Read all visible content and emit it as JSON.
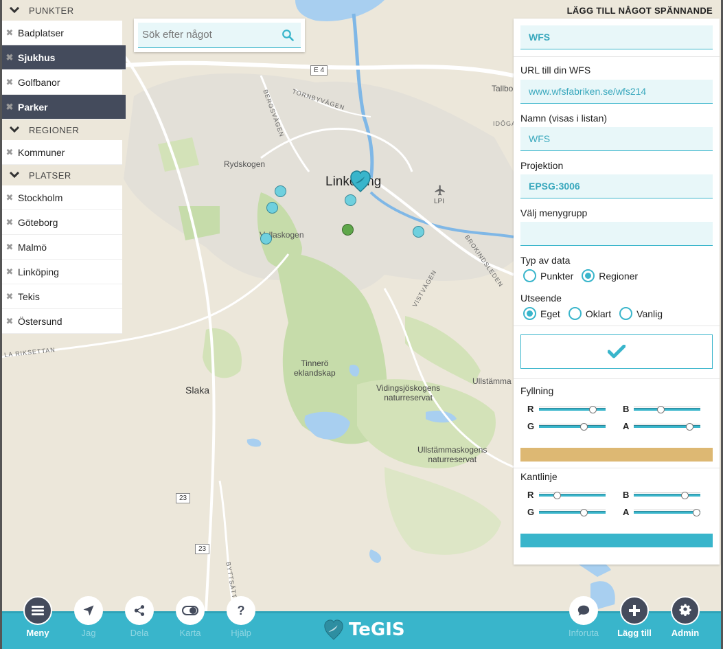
{
  "map": {
    "labels": {
      "city": "Linköping",
      "slaka": "Slaka",
      "rydskogen": "Rydskogen",
      "vallaskogen": "Vallaskogen",
      "lpi": "LPI",
      "tinnero": "Tinnerö\neklandskap",
      "vidingsjo": "Vidingsjöskogens\nnaturreservat",
      "ullstamma_nr": "Ullstämmaskogens\nnaturreservat",
      "ullstamma": "Ullstämma",
      "tallboda": "Tallbo",
      "tornbyvagen": "TORNBYVÄGEN",
      "bergsvagen": "BERGSVÄGEN",
      "idogatan": "IDÖGA",
      "brokindsleden": "BROKINDSLEDEN",
      "vistvagen": "VISTVÄGEN",
      "riksettan": "LA RIKSETTAN",
      "byttsatt": "BYTTSÄTT",
      "e4": "E 4",
      "r23a": "23",
      "r23b": "23"
    }
  },
  "leftmenu": {
    "sections": [
      {
        "title": "PUNKTER",
        "items": [
          "Badplatser",
          "Sjukhus",
          "Golfbanor",
          "Parker"
        ]
      },
      {
        "title": "REGIONER",
        "items": [
          "Kommuner"
        ]
      },
      {
        "title": "PLATSER",
        "items": [
          "Stockholm",
          "Göteborg",
          "Malmö",
          "Linköping",
          "Tekis",
          "Östersund"
        ]
      }
    ]
  },
  "search": {
    "placeholder": "Sök efter något"
  },
  "panel": {
    "title": "LÄGG TILL NÅGOT SPÄNNANDE",
    "type_field": "WFS",
    "url_label": "URL till din WFS",
    "url_value": "www.wfsfabriken.se/wfs214",
    "name_label": "Namn (visas i listan)",
    "name_value": "WFS",
    "projection_label": "Projektion",
    "projection_value": "EPSG:3006",
    "menugroup_label": "Välj menygrupp",
    "menugroup_value": "",
    "datatype_label": "Typ av data",
    "datatype_options": [
      "Punkter",
      "Regioner"
    ],
    "datatype_selected": "Regioner",
    "appearance_label": "Utseende",
    "appearance_options": [
      "Eget",
      "Oklart",
      "Vanlig"
    ],
    "appearance_selected": "Eget",
    "fill_label": "Fyllning",
    "stroke_label": "Kantlinje",
    "channel_labels": {
      "r": "R",
      "g": "G",
      "b": "B",
      "a": "A"
    },
    "fill_values": {
      "r": 0.8,
      "g": 0.67,
      "b": 0.4,
      "a": 0.84
    },
    "stroke_values": {
      "r": 0.27,
      "g": 0.67,
      "b": 0.76,
      "a": 0.94
    },
    "fill_color": "#ddb873",
    "stroke_color": "#39b5cb"
  },
  "bottombar": {
    "brand": "TeGIS",
    "buttons": [
      {
        "label": "Meny",
        "icon": "menu-icon"
      },
      {
        "label": "Jag",
        "icon": "location-arrow-icon"
      },
      {
        "label": "Dela",
        "icon": "share-icon"
      },
      {
        "label": "Karta",
        "icon": "toggle-icon"
      },
      {
        "label": "Hjälp",
        "icon": "help-icon"
      },
      {
        "label": "Inforuta",
        "icon": "speech-bubble-icon"
      },
      {
        "label": "Lägg till",
        "icon": "plus-icon"
      },
      {
        "label": "Admin",
        "icon": "gear-icon"
      }
    ]
  },
  "colors": {
    "accent": "#39b5cb",
    "dark": "#444b5c"
  }
}
